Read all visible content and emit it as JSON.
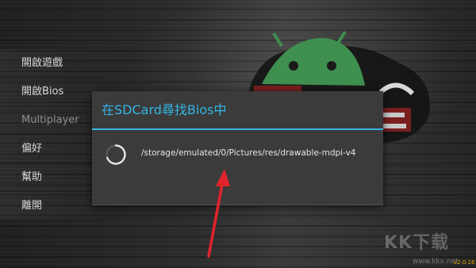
{
  "menu": {
    "items": [
      {
        "label": "開啟遊戲",
        "dim": false
      },
      {
        "label": "開啟Bios",
        "dim": false
      },
      {
        "label": "Multiplayer",
        "dim": true
      },
      {
        "label": "偏好",
        "dim": false
      },
      {
        "label": "幫助",
        "dim": false
      },
      {
        "label": "離開",
        "dim": false
      }
    ]
  },
  "dialog": {
    "title": "在SDCard尋找Bios中",
    "message": "/storage/emulated/0/Pictures/res/drawable-mdpi-v4",
    "spinner_icon": "loading-spinner-icon"
  },
  "watermark": {
    "brand": "KK下载",
    "url": "www.kkx.net"
  },
  "version": "v2.0.16",
  "colors": {
    "accent": "#33b5e5",
    "dialog_bg": "#3b3b3b",
    "arrow": "#e0242b",
    "android_green": "#3ddc84",
    "version": "#e0a000"
  },
  "icons": {
    "arrow": "annotation-arrow-icon",
    "logo": "android-logo-icon"
  }
}
